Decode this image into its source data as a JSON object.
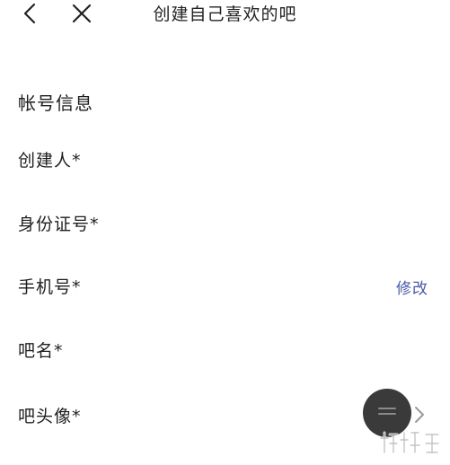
{
  "header": {
    "back_icon": "chevron-left-icon",
    "close_icon": "close-icon",
    "title": "创建自己喜欢的吧"
  },
  "section": {
    "title": "帐号信息"
  },
  "form": {
    "creator_label": "创建人*",
    "id_label": "身份证号*",
    "phone_label": "手机号*",
    "edit_label": "修改",
    "barname_label": "吧名*",
    "avatar_label": "吧头像*"
  },
  "colors": {
    "accent": "#4a5aa8",
    "text": "#1e1e1e",
    "fab": "#3a3a3a"
  }
}
